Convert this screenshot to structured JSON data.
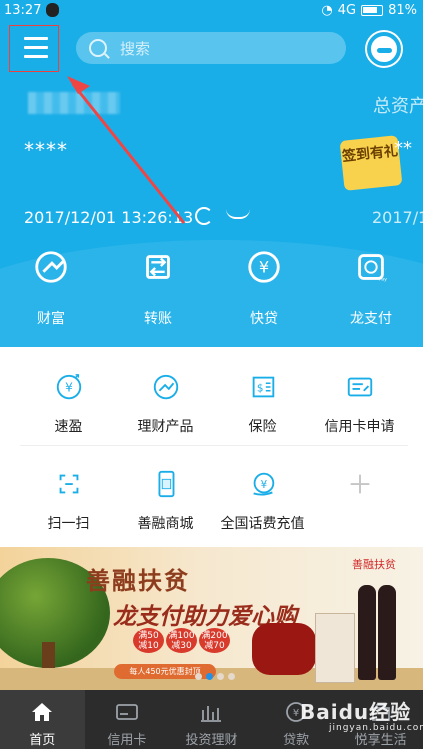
{
  "status_bar": {
    "time": "13:27",
    "network": "4G",
    "battery": "81%"
  },
  "header": {
    "search_placeholder": "搜索"
  },
  "account": {
    "total_asset_label": "总资产",
    "masked_balance": "****",
    "masked_balance_right": "**",
    "timestamp": "2017/12/01 13:26:13",
    "right_date": "2017/1",
    "sign_in_badge": "签到有礼"
  },
  "quick_actions": [
    {
      "label": "财富"
    },
    {
      "label": "转账"
    },
    {
      "label": "快贷"
    },
    {
      "label": "龙支付"
    }
  ],
  "services": [
    {
      "label": "速盈"
    },
    {
      "label": "理财产品"
    },
    {
      "label": "保险"
    },
    {
      "label": "信用卡申请"
    },
    {
      "label": "扫一扫"
    },
    {
      "label": "善融商城"
    },
    {
      "label": "全国话费充值"
    }
  ],
  "banner": {
    "title": "善融扶贫",
    "subtitle": "龙支付助力爱心购",
    "logo": "善融扶贫",
    "offers": [
      {
        "line1": "满50",
        "line2": "减10"
      },
      {
        "line1": "满100",
        "line2": "减30"
      },
      {
        "line1": "满200",
        "line2": "减70"
      }
    ],
    "promo": "每人450元优惠封顶",
    "current_slide": 1
  },
  "bottom_tabs": [
    {
      "label": "首页",
      "active": true
    },
    {
      "label": "信用卡",
      "active": false
    },
    {
      "label": "投资理财",
      "active": false
    },
    {
      "label": "贷款",
      "active": false
    },
    {
      "label": "悦享生活",
      "active": false
    }
  ],
  "watermark": {
    "brand": "Baidu经验",
    "url": "jingyan.baidu.com"
  },
  "colors": {
    "primary": "#1aaee8",
    "highlight": "#ef4040",
    "tab_background": "#2c2c2c"
  }
}
